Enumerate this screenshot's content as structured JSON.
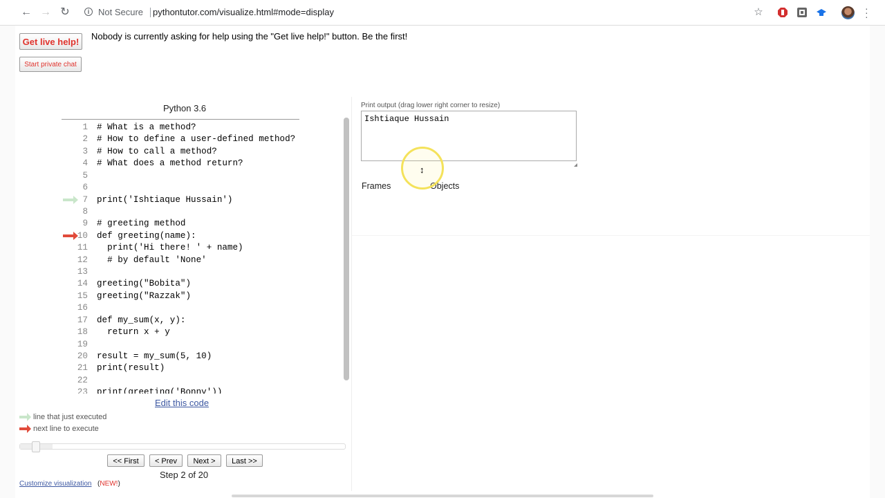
{
  "browser": {
    "back_icon": "←",
    "forward_icon": "→",
    "reload_icon": "↻",
    "security_text": "Not Secure",
    "url": "pythontutor.com/visualize.html#mode=display",
    "bookmark_icon": "☆"
  },
  "help": {
    "live_help_label": "Get live help!",
    "message": "Nobody is currently asking for help using the \"Get live help!\" button. Be the first!",
    "private_chat_label": "Start private chat"
  },
  "code": {
    "language": "Python 3.6",
    "lines": [
      {
        "n": "1",
        "text": "# What is a method?",
        "arrow": ""
      },
      {
        "n": "2",
        "text": "# How to define a user-defined method?",
        "arrow": ""
      },
      {
        "n": "3",
        "text": "# How to call a method?",
        "arrow": ""
      },
      {
        "n": "4",
        "text": "# What does a method return?",
        "arrow": ""
      },
      {
        "n": "5",
        "text": "",
        "arrow": ""
      },
      {
        "n": "6",
        "text": "",
        "arrow": ""
      },
      {
        "n": "7",
        "text": "print('Ishtiaque Hussain')",
        "arrow": "green"
      },
      {
        "n": "8",
        "text": "",
        "arrow": ""
      },
      {
        "n": "9",
        "text": "# greeting method",
        "arrow": ""
      },
      {
        "n": "10",
        "text": "def greeting(name):",
        "arrow": "red"
      },
      {
        "n": "11",
        "text": "  print('Hi there! ' + name)",
        "arrow": ""
      },
      {
        "n": "12",
        "text": "  # by default 'None'",
        "arrow": ""
      },
      {
        "n": "13",
        "text": "",
        "arrow": ""
      },
      {
        "n": "14",
        "text": "greeting(\"Bobita\")",
        "arrow": ""
      },
      {
        "n": "15",
        "text": "greeting(\"Razzak\")",
        "arrow": ""
      },
      {
        "n": "16",
        "text": "",
        "arrow": ""
      },
      {
        "n": "17",
        "text": "def my_sum(x, y):",
        "arrow": ""
      },
      {
        "n": "18",
        "text": "  return x + y",
        "arrow": ""
      },
      {
        "n": "19",
        "text": "",
        "arrow": ""
      },
      {
        "n": "20",
        "text": "result = my_sum(5, 10)",
        "arrow": ""
      },
      {
        "n": "21",
        "text": "print(result)",
        "arrow": ""
      },
      {
        "n": "22",
        "text": "",
        "arrow": ""
      },
      {
        "n": "23",
        "text": "print(greeting('Bonny'))",
        "arrow": ""
      }
    ],
    "edit_link": "Edit this code"
  },
  "legend": {
    "just_executed": "line that just executed",
    "next_line": "next line to execute"
  },
  "navigation": {
    "first": "<< First",
    "prev": "< Prev",
    "next": "Next >",
    "last": "Last >>",
    "step_status": "Step 2 of 20",
    "progress": 0.1
  },
  "footer": {
    "customize": "Customize visualization",
    "new_open": "(",
    "new": "NEW!",
    "new_close": ")"
  },
  "output": {
    "label": "Print output (drag lower right corner to resize)",
    "text": "Ishtiaque Hussain",
    "frames_label": "Frames",
    "objects_label": "Objects"
  },
  "colors": {
    "accent_red": "#e0332d",
    "link_blue": "#3d58a2",
    "arrow_green": "#c9e6ca",
    "arrow_red": "#e14b3b"
  }
}
